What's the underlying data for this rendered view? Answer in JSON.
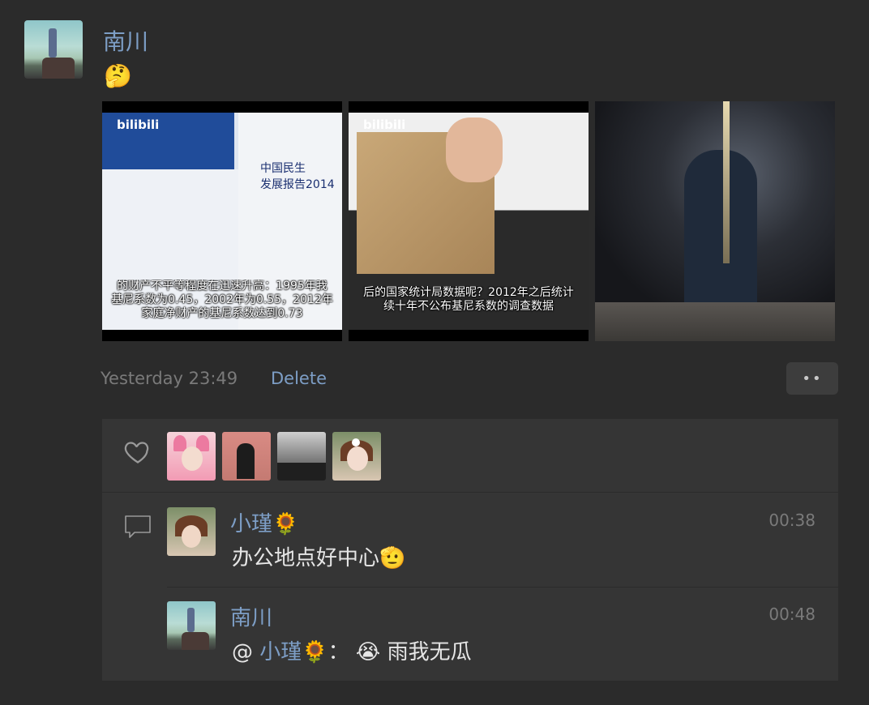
{
  "post": {
    "author": "南川",
    "text_emoji": "🤔",
    "timestamp": "Yesterday 23:49",
    "delete_label": "Delete",
    "more_label": "••",
    "photos": [
      {
        "overlay_logo": "bilibili",
        "book_title_1": "中国民生",
        "book_title_2": "发展报告2014",
        "caption_line1": "的财产不平等程度在迅速升高：1995年我",
        "caption_line2": "基尼系数为0.45，2002年为0.55，2012年",
        "caption_line3": "家庭净财产的基尼系数达到0.73"
      },
      {
        "overlay_logo": "bilibili",
        "caption_line1": "后的国家统计局数据呢？2012年之后统计",
        "caption_line2": "续十年不公布基尼系数的调查数据"
      },
      {}
    ]
  },
  "likes": {
    "icon": "heart-icon",
    "count": 4
  },
  "comments": [
    {
      "name": "小瑾🌻",
      "time": "00:38",
      "text": "办公地点好中心🫡"
    },
    {
      "name": "南川",
      "time": "00:48",
      "at": "@",
      "mention": "小瑾🌻",
      "colon": "：",
      "text": "😭 雨我无瓜"
    }
  ],
  "colors": {
    "background": "#2b2b2b",
    "panel": "#353535",
    "link": "#7d9ec6",
    "muted": "#7a7a7a"
  }
}
